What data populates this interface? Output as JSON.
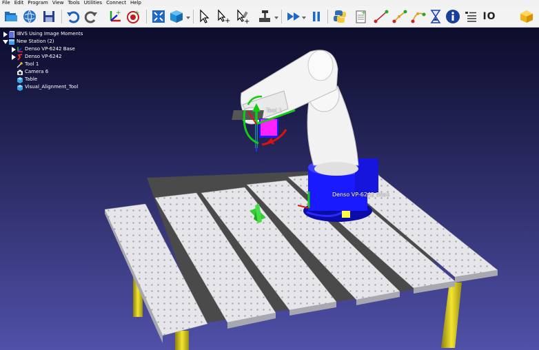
{
  "menu": [
    "File",
    "Edit",
    "Program",
    "View",
    "Tools",
    "Utilities",
    "Connect",
    "Help"
  ],
  "toolbar": {
    "io_label": "IO"
  },
  "tree": {
    "items": [
      {
        "label": "IBVS Using Image Moments",
        "expander": "collapsed",
        "icon": "document-icon"
      },
      {
        "label": "New Station (2)",
        "expander": "expanded",
        "icon": "station-icon"
      },
      {
        "label": "Denso VP-6242 Base",
        "expander": "collapsed",
        "icon": "frame-icon"
      },
      {
        "label": "Denso VP-6242",
        "expander": "collapsed",
        "icon": "robot-icon"
      },
      {
        "label": "Tool 1",
        "expander": "none",
        "icon": "tool-icon"
      },
      {
        "label": "Camera 6",
        "expander": "none",
        "icon": "camera-icon"
      },
      {
        "label": "Table",
        "expander": "none",
        "icon": "object-icon"
      },
      {
        "label": "Visual_Alignment_Tool",
        "expander": "none",
        "icon": "object-icon"
      }
    ]
  },
  "scene": {
    "tool_label": "Tool 1",
    "base_label": "Denso VP-6242 Base",
    "robot_label": "Denso VP-6242"
  },
  "colors": {
    "background_top": "#0c0c2c",
    "background_bottom": "#5050a8",
    "robot": "#f0f0f0",
    "base": "#1a1aff",
    "table_plate": "#e8e8ec",
    "table_leg": "#e0d020",
    "target_marker": "#33cc33",
    "camera_tag": "#ff22ff"
  }
}
